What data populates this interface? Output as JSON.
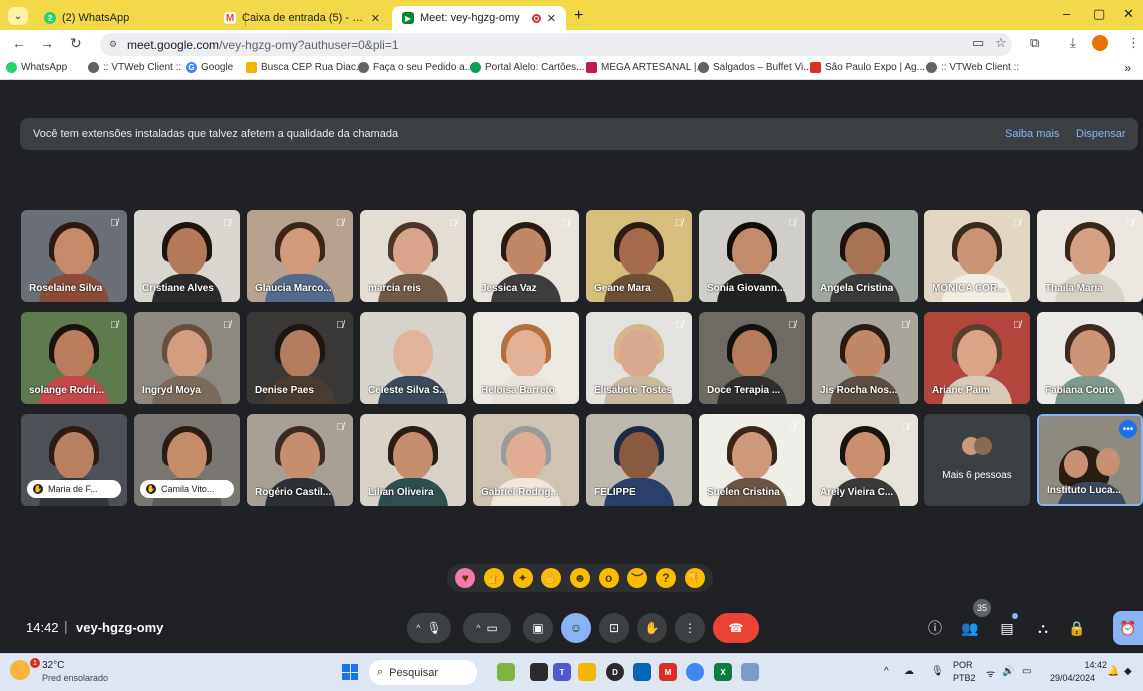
{
  "browser": {
    "tabs": [
      {
        "label": "(2) WhatsApp",
        "icon": "whatsapp-icon",
        "color": "#25d366",
        "active": false
      },
      {
        "label": "Caixa de entrada (5) - instituto",
        "icon": "gmail-icon",
        "color": "#ea4335",
        "active": false
      },
      {
        "label": "Meet: vey-hgzg-omy",
        "icon": "meet-icon",
        "color": "#00832d",
        "active": true
      }
    ],
    "url_host": "meet.google.com",
    "url_path": "/vey-hgzg-omy?authuser=0&pli=1",
    "bookmarks": [
      {
        "label": "WhatsApp",
        "color": "#25d366"
      },
      {
        "label": ":: VTWeb Client ::",
        "color": "#5f6368"
      },
      {
        "label": "Google",
        "color": "#4285f4"
      },
      {
        "label": "Busca CEP Rua Diac...",
        "color": "#f4b400"
      },
      {
        "label": "Faça o seu Pedido a...",
        "color": "#5f6368"
      },
      {
        "label": "Portal Alelo: Cartões...",
        "color": "#0f9d58"
      },
      {
        "label": "MEGA ARTESANAL |...",
        "color": "#c2185b"
      },
      {
        "label": "Salgados – Buffet Vi...",
        "color": "#5f6368"
      },
      {
        "label": "São Paulo Expo | Ag...",
        "color": "#d93025"
      },
      {
        "label": ":: VTWeb Client ::",
        "color": "#5f6368"
      }
    ],
    "bookmarks_more": "»"
  },
  "meet": {
    "banner": {
      "text": "Você tem extensões instaladas que talvez afetem a qualidade da chamada",
      "learn_more": "Saiba mais",
      "dismiss": "Dispensar"
    },
    "participants": [
      {
        "name": "Roselaine Silva",
        "muted": true,
        "skin": "#c68a6a",
        "hair": "#2a1a12",
        "bg": "#6b6f78",
        "shirt": "#8a4b3a"
      },
      {
        "name": "Cristiane Alves",
        "muted": true,
        "skin": "#b27a58",
        "hair": "#1e140e",
        "bg": "#d9d6cf",
        "shirt": "#2b2b2b"
      },
      {
        "name": "Glaucia Marco...",
        "muted": true,
        "skin": "#d39a7c",
        "hair": "#3a2516",
        "bg": "#b6a28e",
        "shirt": "#556b8a"
      },
      {
        "name": "marcia reis",
        "muted": true,
        "skin": "#d8a58a",
        "hair": "#4b3628",
        "bg": "#e4ddd3",
        "shirt": "#705a48"
      },
      {
        "name": "Jessica Vaz",
        "muted": true,
        "skin": "#c18868",
        "hair": "#2a1b12",
        "bg": "#e8e4dc",
        "shirt": "#3d3d3d"
      },
      {
        "name": "Geane Mara",
        "muted": true,
        "skin": "#a66a4c",
        "hair": "#2b1b12",
        "bg": "#d6bf7c",
        "shirt": "#6b4f36"
      },
      {
        "name": "Sonia Giovann...",
        "muted": true,
        "skin": "#c48a6c",
        "hair": "#120c08",
        "bg": "#d0cec8",
        "shirt": "#222222"
      },
      {
        "name": "Angela Cristina",
        "muted": false,
        "skin": "#a77353",
        "hair": "#1b120c",
        "bg": "#9fa8a0",
        "shirt": "#3a3a3a"
      },
      {
        "name": "MONICA COR...",
        "muted": true,
        "skin": "#c89474",
        "hair": "#3a2a1c",
        "bg": "#e2d7c4",
        "shirt": "#f2ece4"
      },
      {
        "name": "Thaila Maria",
        "muted": true,
        "skin": "#d6a083",
        "hair": "#3a2618",
        "bg": "#ebe6df",
        "shirt": "#d9d2c8"
      },
      {
        "name": "solange Rodri...",
        "muted": true,
        "skin": "#b97c5c",
        "hair": "#1c120c",
        "bg": "#5e7a4e",
        "shirt": "#c44a4a"
      },
      {
        "name": "Ingryd Moya",
        "muted": true,
        "skin": "#d19e82",
        "hair": "#6a4e38",
        "bg": "#8d8880",
        "shirt": "#7a6b5c"
      },
      {
        "name": "Denise Paes",
        "muted": true,
        "skin": "#b27c5e",
        "hair": "#1f150f",
        "bg": "#3a3836",
        "shirt": "#4a3b30"
      },
      {
        "name": "Celeste Silva S...",
        "muted": false,
        "skin": "#e0b49a",
        "hair": "#d8d2c8",
        "bg": "#d8d4cc",
        "shirt": "#3a4a5a"
      },
      {
        "name": "Heloisa Barreto",
        "muted": false,
        "skin": "#e3b196",
        "hair": "#b3703d",
        "bg": "#ece8e2",
        "shirt": "#e8e2da"
      },
      {
        "name": "Elisabete Tostes",
        "muted": true,
        "skin": "#d9a88c",
        "hair": "#d6b48a",
        "bg": "#e4e2de",
        "shirt": "#c9b99f"
      },
      {
        "name": "Doce Terapia ...",
        "muted": true,
        "skin": "#b57b5a",
        "hair": "#111111",
        "bg": "#6f6a62",
        "shirt": "#2e2e2e"
      },
      {
        "name": "Jis Rocha Nos...",
        "muted": true,
        "skin": "#c28866",
        "hair": "#2a1c14",
        "bg": "#a9a59c",
        "shirt": "#5c4e42"
      },
      {
        "name": "Ariane Paim",
        "muted": true,
        "skin": "#d9a488",
        "hair": "#5a3f2c",
        "bg": "#b2463c",
        "shirt": "#d8c9b8"
      },
      {
        "name": "Fabiana Couto",
        "muted": false,
        "skin": "#cc9676",
        "hair": "#3c2a1e",
        "bg": "#eceae6",
        "shirt": "#7d9a8a"
      },
      {
        "name": "Maria de F...",
        "muted": false,
        "pill": true,
        "skin": "#b78063",
        "hair": "#2a1c14",
        "bg": "#4f5158",
        "shirt": "#33363c"
      },
      {
        "name": "Camila Vito...",
        "muted": false,
        "pill": true,
        "skin": "#c58c6a",
        "hair": "#2c1d13",
        "bg": "#7a7772",
        "shirt": "#5c5a56"
      },
      {
        "name": "Rogério Castil...",
        "muted": true,
        "skin": "#c48d6e",
        "hair": "#3a2a20",
        "bg": "#a79f94",
        "shirt": "#2c2f36"
      },
      {
        "name": "Lilian Oliveira",
        "muted": false,
        "skin": "#c58d6d",
        "hair": "#2a1d14",
        "bg": "#d8d2c8",
        "shirt": "#2f4f4f"
      },
      {
        "name": "Gabriel Rodrig...",
        "muted": false,
        "skin": "#e0ad92",
        "hair": "#9a9a9a",
        "bg": "#cfc4b4",
        "shirt": "#f0e6dc"
      },
      {
        "name": "FELIPPE",
        "muted": false,
        "skin": "#8a5a3e",
        "hair": "#1e2a44",
        "bg": "#bdb8ae",
        "shirt": "#2a3f6a"
      },
      {
        "name": "Suelen Cristina",
        "muted": true,
        "skin": "#cf9a7c",
        "hair": "#3a2619",
        "bg": "#f0eee9",
        "shirt": "#6a5446"
      },
      {
        "name": "Arely Vieira C...",
        "muted": true,
        "skin": "#c98f6f",
        "hair": "#1a120c",
        "bg": "#e6e2da",
        "shirt": "#3a3a3a"
      }
    ],
    "more_people_label": "Mais 6 pessoas",
    "self_tile": {
      "name": "Instituto Luca...",
      "skin": "#c89070",
      "hair": "#2a1d14",
      "bg": "#8f8a80",
      "shirt": "#3c4a5e"
    },
    "reactions": [
      {
        "name": "heart-emoji",
        "glyph": "♥",
        "color": "#f27ba8"
      },
      {
        "name": "thumbs-up-emoji",
        "glyph": "👍",
        "color": "#fbbc04"
      },
      {
        "name": "party-popper-emoji",
        "glyph": "✦",
        "color": "#fbbc04"
      },
      {
        "name": "clapping-emoji",
        "glyph": "✋",
        "color": "#fbbc04"
      },
      {
        "name": "laughing-emoji",
        "glyph": "☻",
        "color": "#fbbc04"
      },
      {
        "name": "surprised-emoji",
        "glyph": "o",
        "color": "#fbbc04"
      },
      {
        "name": "crying-emoji",
        "glyph": "︶",
        "color": "#fbbc04"
      },
      {
        "name": "thinking-emoji",
        "glyph": "?",
        "color": "#fbbc04"
      },
      {
        "name": "thumbs-down-emoji",
        "glyph": "👎",
        "color": "#fbbc04"
      }
    ],
    "time": "14:42",
    "separator": "|",
    "meeting_code": "vey-hgzg-omy",
    "people_count": "35"
  },
  "taskbar": {
    "temperature": "32°C",
    "weather": "Pred ensolarado",
    "weather_badge": "1",
    "search_placeholder": "Pesquisar",
    "lang_top": "POR",
    "lang_bottom": "PTB2",
    "clock_time": "14:42",
    "clock_date": "29/04/2024"
  },
  "colors": {
    "meet_bg": "#202124",
    "tile_bg": "#3c4043",
    "accent": "#8ab4f8",
    "hangup": "#ea4335",
    "tabstrip": "#f2d94a"
  }
}
